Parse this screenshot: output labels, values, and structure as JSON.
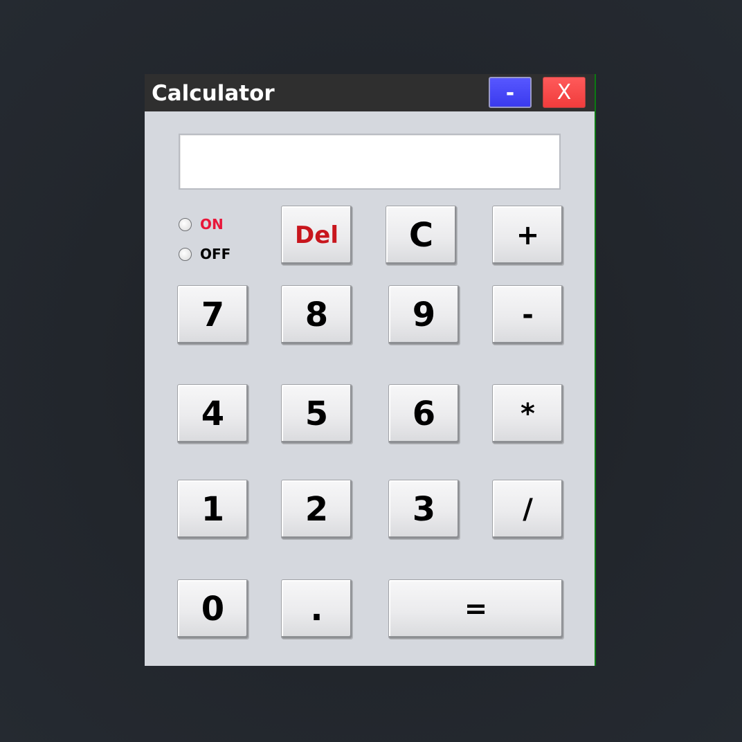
{
  "window": {
    "title": "Calculator",
    "minimize_label": "-",
    "close_label": "X"
  },
  "display": {
    "value": ""
  },
  "power": {
    "on_label": "ON",
    "off_label": "OFF",
    "on_color": "#e8173a",
    "off_color": "#000000",
    "selected": "none"
  },
  "keys": {
    "del": "Del",
    "clear": "C",
    "plus": "+",
    "seven": "7",
    "eight": "8",
    "nine": "9",
    "minus": "-",
    "four": "4",
    "five": "5",
    "six": "6",
    "multiply": "*",
    "one": "1",
    "two": "2",
    "three": "3",
    "divide": "/",
    "zero": "0",
    "dot": ".",
    "equals": "="
  },
  "colors": {
    "titlebar": "#2f2f2f",
    "body": "#d5d8de",
    "minimize_button": "#4a4aff",
    "close_button": "#f54848",
    "del_text": "#c8161d"
  }
}
